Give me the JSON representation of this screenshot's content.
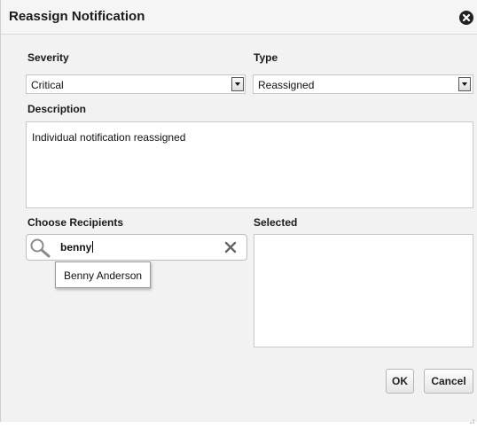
{
  "dialog": {
    "title": "Reassign Notification",
    "close_icon": "close-circle-icon"
  },
  "severity": {
    "label": "Severity",
    "value": "Critical"
  },
  "type": {
    "label": "Type",
    "value": "Reassigned"
  },
  "description": {
    "label": "Description",
    "value": "Individual notification reassigned"
  },
  "recipients": {
    "label": "Choose Recipients",
    "search_value": "benny",
    "search_icon": "magnifier-icon",
    "clear_icon": "clear-x-icon",
    "suggestions": [
      "Benny Anderson"
    ]
  },
  "selected": {
    "label": "Selected",
    "items": []
  },
  "buttons": {
    "ok": "OK",
    "cancel": "Cancel"
  },
  "colors": {
    "dialog_bg": "#f2f2f2",
    "field_border": "#c8c8c8"
  }
}
